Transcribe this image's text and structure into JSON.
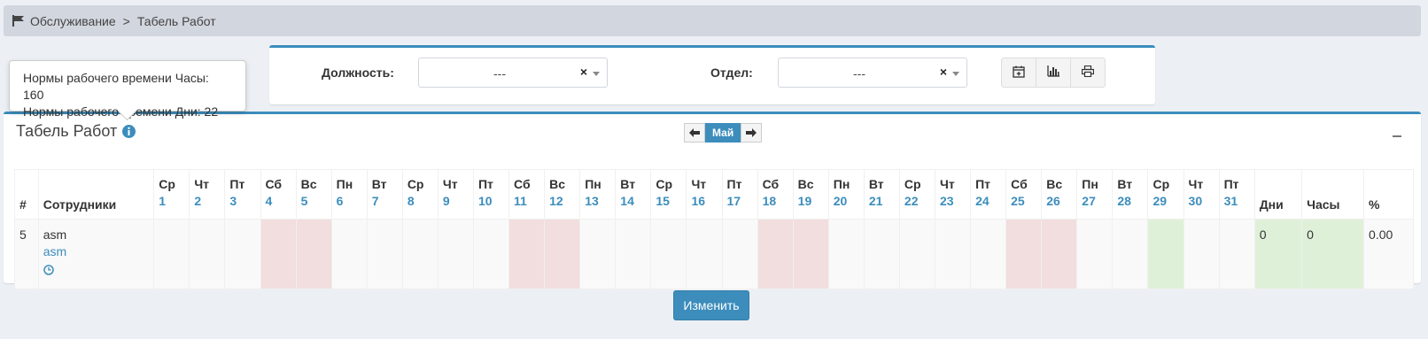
{
  "breadcrumb": {
    "items": [
      "Обслуживание",
      "Табель Работ"
    ],
    "separator": ">"
  },
  "filters": {
    "position_label": "Должность:",
    "position_value": "---",
    "department_label": "Отдел:",
    "department_value": "---",
    "clear_symbol": "×"
  },
  "tooltip": {
    "line1": "Нормы рабочего времени Часы: 160",
    "line2": "Нормы рабочего времени Дни: 22"
  },
  "box": {
    "title": "Табель Работ"
  },
  "month_nav": {
    "month": "Май"
  },
  "table": {
    "headers": {
      "num": "#",
      "employees": "Сотрудники",
      "days": "Дни",
      "hours": "Часы",
      "percent": "%"
    },
    "day_columns": [
      {
        "dow": "Ср",
        "day": "1",
        "type": "normal"
      },
      {
        "dow": "Чт",
        "day": "2",
        "type": "normal"
      },
      {
        "dow": "Пт",
        "day": "3",
        "type": "normal"
      },
      {
        "dow": "Сб",
        "day": "4",
        "type": "weekend"
      },
      {
        "dow": "Вс",
        "day": "5",
        "type": "weekend"
      },
      {
        "dow": "Пн",
        "day": "6",
        "type": "normal"
      },
      {
        "dow": "Вт",
        "day": "7",
        "type": "normal"
      },
      {
        "dow": "Ср",
        "day": "8",
        "type": "normal"
      },
      {
        "dow": "Чт",
        "day": "9",
        "type": "normal"
      },
      {
        "dow": "Пт",
        "day": "10",
        "type": "normal"
      },
      {
        "dow": "Сб",
        "day": "11",
        "type": "weekend"
      },
      {
        "dow": "Вс",
        "day": "12",
        "type": "weekend"
      },
      {
        "dow": "Пн",
        "day": "13",
        "type": "normal"
      },
      {
        "dow": "Вт",
        "day": "14",
        "type": "normal"
      },
      {
        "dow": "Ср",
        "day": "15",
        "type": "normal"
      },
      {
        "dow": "Чт",
        "day": "16",
        "type": "normal"
      },
      {
        "dow": "Пт",
        "day": "17",
        "type": "normal"
      },
      {
        "dow": "Сб",
        "day": "18",
        "type": "weekend"
      },
      {
        "dow": "Вс",
        "day": "19",
        "type": "weekend"
      },
      {
        "dow": "Пн",
        "day": "20",
        "type": "normal"
      },
      {
        "dow": "Вт",
        "day": "21",
        "type": "normal"
      },
      {
        "dow": "Ср",
        "day": "22",
        "type": "normal"
      },
      {
        "dow": "Чт",
        "day": "23",
        "type": "normal"
      },
      {
        "dow": "Пт",
        "day": "24",
        "type": "normal"
      },
      {
        "dow": "Сб",
        "day": "25",
        "type": "weekend"
      },
      {
        "dow": "Вс",
        "day": "26",
        "type": "weekend"
      },
      {
        "dow": "Пн",
        "day": "27",
        "type": "normal"
      },
      {
        "dow": "Вт",
        "day": "28",
        "type": "normal"
      },
      {
        "dow": "Ср",
        "day": "29",
        "type": "highlight"
      },
      {
        "dow": "Чт",
        "day": "30",
        "type": "normal"
      },
      {
        "dow": "Пт",
        "day": "31",
        "type": "normal"
      }
    ],
    "rows": [
      {
        "num": "5",
        "name": "asm",
        "link": "asm",
        "days": "0",
        "hours": "0",
        "percent": "0.00"
      }
    ]
  },
  "actions": {
    "edit_label": "Изменить"
  },
  "colors": {
    "accent": "#3c8dbc",
    "weekend": "#f2dede",
    "highlight": "#dff0d8"
  },
  "icons": [
    "flag-icon",
    "calendar-plus-icon",
    "bar-chart-icon",
    "print-icon",
    "info-icon",
    "clock-icon",
    "arrow-left-icon",
    "arrow-right-icon",
    "minus-icon"
  ]
}
